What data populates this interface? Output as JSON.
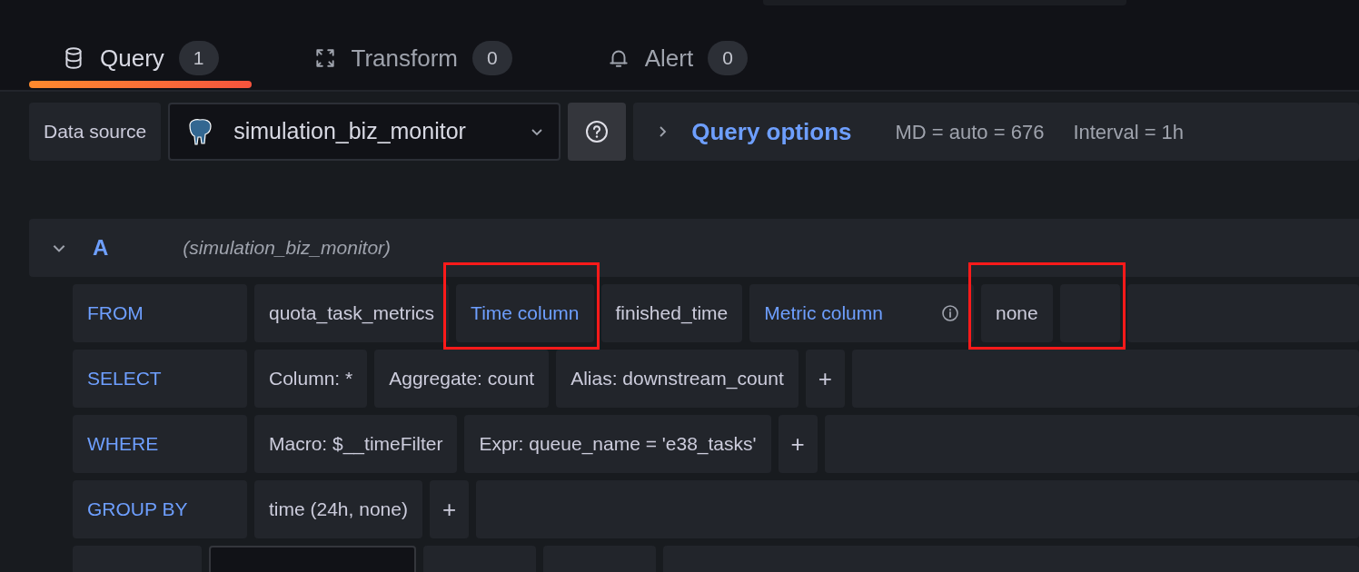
{
  "tabs": [
    {
      "kind": "database",
      "label": "Query",
      "count": "1",
      "selected": true
    },
    {
      "kind": "transform",
      "label": "Transform",
      "count": "0",
      "selected": false
    },
    {
      "kind": "bell",
      "label": "Alert",
      "count": "0",
      "selected": false
    }
  ],
  "data_source": {
    "label": "Data source",
    "value": "simulation_biz_monitor"
  },
  "query_options": {
    "label": "Query options",
    "md": "MD = auto = 676",
    "interval": "Interval = 1h"
  },
  "query": {
    "letter": "A",
    "source": "(simulation_biz_monitor)",
    "expanded": true
  },
  "rows": [
    {
      "label": "FROM",
      "cells": [
        {
          "kind": "value",
          "text": "quota_task_metrics",
          "highlighted": false
        },
        {
          "kind": "keyword",
          "text": "Time column",
          "highlighted": true
        },
        {
          "kind": "value",
          "text": "finished_time",
          "highlighted": false
        },
        {
          "kind": "keyword",
          "text": "Metric column",
          "info": true,
          "highlighted": false
        },
        {
          "kind": "value",
          "text": "none",
          "highlighted": true
        },
        {
          "kind": "empty",
          "highlighted": true
        }
      ]
    },
    {
      "label": "SELECT",
      "cells": [
        {
          "kind": "value",
          "text": "Column: *",
          "highlighted": false
        },
        {
          "kind": "value",
          "text": "Aggregate: count",
          "highlighted": false
        },
        {
          "kind": "value",
          "text": "Alias: downstream_count",
          "highlighted": false
        },
        {
          "kind": "add",
          "text": "+",
          "highlighted": false
        }
      ]
    },
    {
      "label": "WHERE",
      "cells": [
        {
          "kind": "value",
          "text": "Macro: $__timeFilter",
          "highlighted": false
        },
        {
          "kind": "value",
          "text": "Expr: queue_name = 'e38_tasks'",
          "highlighted": false
        },
        {
          "kind": "add",
          "text": "+",
          "highlighted": false
        }
      ]
    },
    {
      "label": "GROUP BY",
      "cells": [
        {
          "kind": "value",
          "text": "time (24h, none)",
          "highlighted": false
        },
        {
          "kind": "add",
          "text": "+",
          "highlighted": false
        }
      ]
    },
    {
      "kind": "format",
      "cells": [
        {
          "kind": "select"
        },
        {
          "kind": "keyword"
        },
        {
          "kind": "keyword"
        }
      ]
    }
  ]
}
